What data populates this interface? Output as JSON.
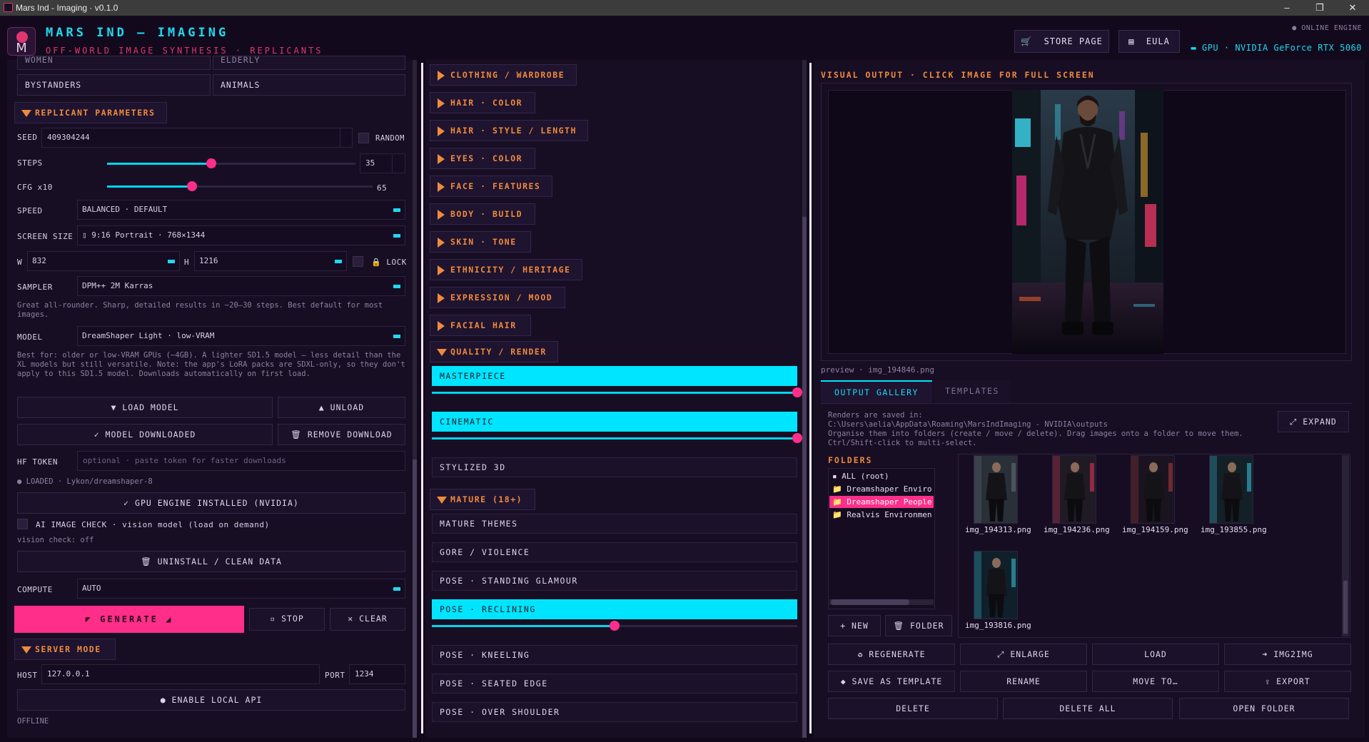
{
  "window": {
    "title": "Mars Ind - Imaging  ·  v0.1.0",
    "min": "–",
    "max": "❐",
    "close": "✕"
  },
  "header": {
    "title": "MARS IND — IMAGING",
    "subtitle": "OFF-WORLD IMAGE SYNTHESIS · REPLICANTS",
    "logo_letter": "M",
    "store_btn": "STORE PAGE",
    "eula_btn": "EULA",
    "online_status": "● ONLINE ENGINE",
    "gpu": "▬ GPU · NVIDIA GeForce RTX 5060"
  },
  "left": {
    "cut_labels": [
      "WOMEN",
      "ELDERLY"
    ],
    "subjects": [
      "BYSTANDERS",
      "ANIMALS"
    ],
    "replicant_section": "REPLICANT PARAMETERS",
    "seed_label": "SEED",
    "seed_value": "409304244",
    "random_label": "RANDOM",
    "steps_label": "STEPS",
    "steps_value": 35,
    "steps_fraction": 0.42,
    "cfg_label": "CFG x10",
    "cfg_value": 65,
    "cfg_fraction": 0.32,
    "speed_label": "SPEED",
    "speed_value": "BALANCED · DEFAULT",
    "screen_label": "SCREEN SIZE",
    "screen_value": "▯ 9:16 Portrait · 768×1344",
    "w_label": "W",
    "w_value": "832",
    "h_label": "H",
    "h_value": "1216",
    "lock_label": "LOCK",
    "sampler_label": "SAMPLER",
    "sampler_value": "DPM++ 2M Karras",
    "sampler_note": "Great all-rounder. Sharp, detailed results in ~20–30 steps. Best default for most images.",
    "model_label": "MODEL",
    "model_value": "DreamShaper Light · low-VRAM",
    "model_note": "Best for: older or low-VRAM GPUs (~4GB). A lighter SD1.5 model — less detail than the XL models but still versatile. Note: the app's LoRA packs are SDXL-only, so they don't apply to this SD1.5 model. Downloads automatically on first load.",
    "load_model": "▼ LOAD MODEL",
    "unload": "▲ UNLOAD",
    "model_downloaded": "✓ MODEL DOWNLOADED",
    "remove_download": "🗑 REMOVE DOWNLOAD",
    "hf_label": "HF TOKEN",
    "hf_placeholder": "optional · paste token for faster downloads",
    "loaded_status": "● LOADED · Lykon/dreamshaper-8",
    "gpu_engine": "✓ GPU ENGINE INSTALLED (NVIDIA)",
    "ai_check": "AI IMAGE CHECK · vision model (load on demand)",
    "vision_status": "vision check: off",
    "uninstall": "🗑 UNINSTALL / CLEAN DATA",
    "compute_label": "COMPUTE",
    "compute_value": "AUTO",
    "generate": "◤ GENERATE ◢",
    "stop": "▫ STOP",
    "clear": "✕ CLEAR",
    "server_section": "SERVER MODE",
    "host_label": "HOST",
    "host_value": "127.0.0.1",
    "port_label": "PORT",
    "port_value": "1234",
    "enable_api": "● ENABLE LOCAL API",
    "server_status": "OFFLINE"
  },
  "middle": {
    "sections": [
      "CLOTHING / WARDROBE",
      "HAIR · COLOR",
      "HAIR · STYLE / LENGTH",
      "EYES · COLOR",
      "FACE · FEATURES",
      "BODY · BUILD",
      "SKIN · TONE",
      "ETHNICITY / HERITAGE",
      "EXPRESSION / MOOD",
      "FACIAL HAIR"
    ],
    "quality_section": "QUALITY / RENDER",
    "quality_tags": [
      {
        "label": "MASTERPIECE",
        "active": true,
        "weight": 1.0
      },
      {
        "label": "CINEMATIC",
        "active": true,
        "weight": 1.0
      },
      {
        "label": "STYLIZED 3D",
        "active": false
      }
    ],
    "mature_section": "MATURE (18+)",
    "mature_tags": [
      {
        "label": "MATURE THEMES",
        "active": false
      },
      {
        "label": "GORE / VIOLENCE",
        "active": false
      },
      {
        "label": "POSE · STANDING GLAMOUR",
        "active": false
      },
      {
        "label": "POSE · RECLINING",
        "active": true,
        "weight": 0.5
      },
      {
        "label": "POSE · KNEELING",
        "active": false
      },
      {
        "label": "POSE · SEATED EDGE",
        "active": false
      },
      {
        "label": "POSE · OVER SHOULDER",
        "active": false
      }
    ]
  },
  "right": {
    "visual_title": "VISUAL OUTPUT  ·  CLICK IMAGE FOR FULL SCREEN",
    "preview_caption": "preview · img_194846.png",
    "tab_gallery": "OUTPUT GALLERY",
    "tab_templates": "TEMPLATES",
    "saved_note": "Renders are saved in:\nC:\\Users\\aelia\\AppData\\Roaming\\MarsIndImaging - NVIDIA\\outputs\nOrganise them into folders (create / move / delete). Drag images onto a folder to move them. Ctrl/Shift-click to multi-select.",
    "expand": "⤢ EXPAND",
    "folders_title": "FOLDERS",
    "folders": [
      "▪ ALL (root)",
      "📁 Dreamshaper Enviro",
      "📁 Dreamshaper People",
      "📁 Realvis Environmen"
    ],
    "selected_folder": 2,
    "new_btn": "+ NEW",
    "folder_btn": "🗑 FOLDER",
    "thumbs": [
      "img_194313.png",
      "img_194236.png",
      "img_194159.png",
      "img_193855.png",
      "img_193816.png"
    ],
    "actions": [
      "♻ REGENERATE",
      "⤢ ENLARGE",
      "LOAD",
      "➜ IMG2IMG",
      "◆ SAVE AS TEMPLATE",
      "RENAME",
      "MOVE TO…",
      "⇪ EXPORT"
    ],
    "bottom": [
      "DELETE",
      "DELETE ALL",
      "OPEN FOLDER"
    ]
  },
  "colors": {
    "accent_cyan": "#00e5ff",
    "accent_pink": "#ff2e8a",
    "accent_orange": "#f08a3c",
    "bg": "#120a1c"
  }
}
